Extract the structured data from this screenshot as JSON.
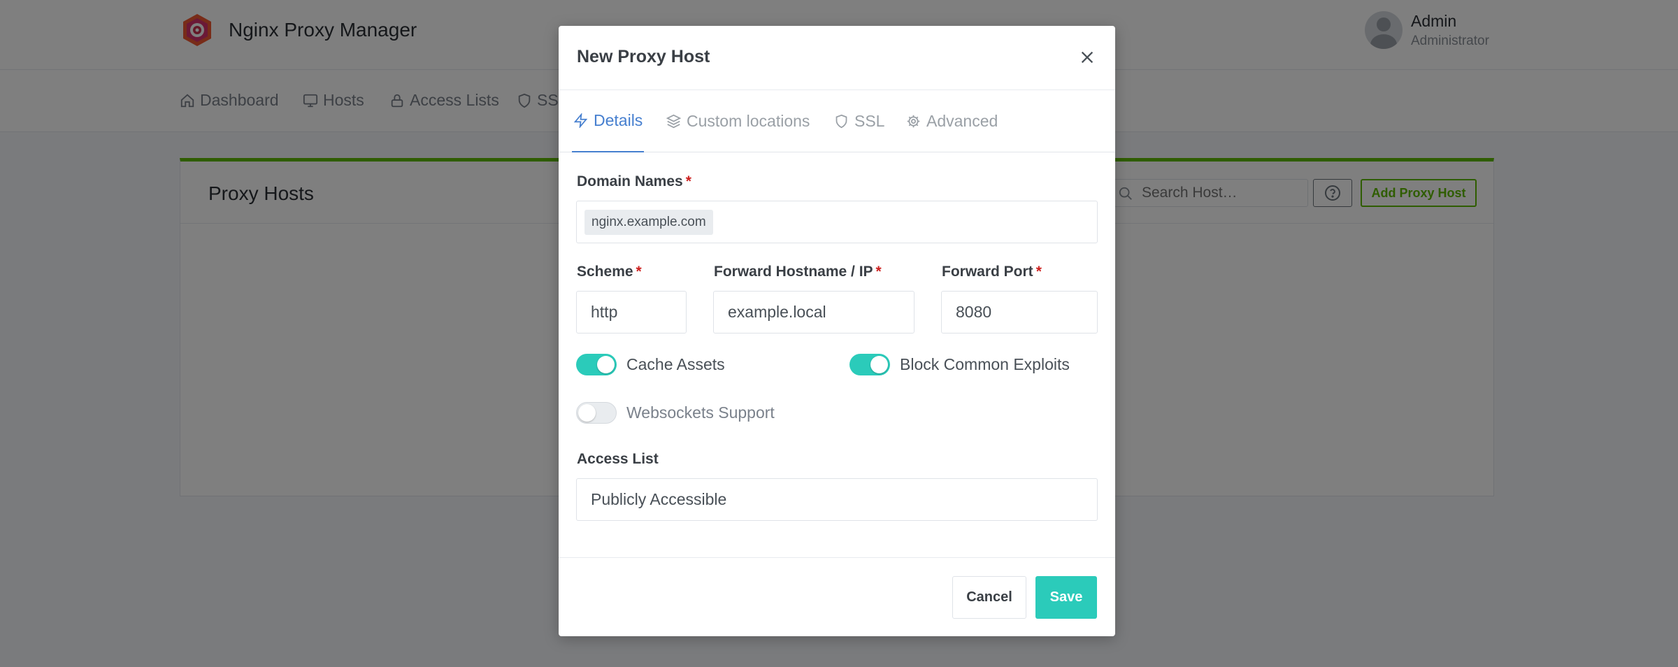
{
  "app": {
    "title": "Nginx Proxy Manager",
    "user": {
      "name": "Admin",
      "role": "Administrator"
    }
  },
  "nav": {
    "items": [
      {
        "label": "Dashboard",
        "icon": "home-icon"
      },
      {
        "label": "Hosts",
        "icon": "monitor-icon"
      },
      {
        "label": "Access Lists",
        "icon": "lock-icon"
      },
      {
        "label": "SSL",
        "icon": "shield-icon"
      }
    ]
  },
  "page": {
    "card_title": "Proxy Hosts",
    "search_placeholder": "Search Host…",
    "add_button": "Add Proxy Host",
    "accent_color": "#5eba00"
  },
  "modal": {
    "title": "New Proxy Host",
    "tabs": [
      {
        "label": "Details",
        "icon": "zap-icon",
        "active": true
      },
      {
        "label": "Custom locations",
        "icon": "layers-icon",
        "active": false
      },
      {
        "label": "SSL",
        "icon": "shield-icon",
        "active": false
      },
      {
        "label": "Advanced",
        "icon": "gear-icon",
        "active": false
      }
    ],
    "fields": {
      "domain_names_label": "Domain Names",
      "domain_names_value": "nginx.example.com",
      "scheme_label": "Scheme",
      "scheme_value": "http",
      "forward_host_label": "Forward Hostname / IP",
      "forward_host_value": "example.local",
      "forward_port_label": "Forward Port",
      "forward_port_value": "8080",
      "required_mark": "*",
      "access_list_label": "Access List",
      "access_list_value": "Publicly Accessible"
    },
    "toggles": {
      "cache_assets": {
        "label": "Cache Assets",
        "on": true
      },
      "block_exploits": {
        "label": "Block Common Exploits",
        "on": true
      },
      "websockets": {
        "label": "Websockets Support",
        "on": false
      }
    },
    "buttons": {
      "cancel": "Cancel",
      "save": "Save"
    },
    "colors": {
      "primary": "#2bcbba",
      "tab_active": "#467fcf",
      "required": "#cd201f"
    }
  }
}
